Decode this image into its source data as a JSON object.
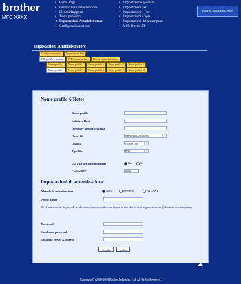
{
  "brand": {
    "logo": "brother",
    "model": "MFC-XXXX"
  },
  "nav": {
    "col1": [
      "Home Page",
      "Informazioni manutenzione",
      "Elenchi/Rapporti",
      "Trova periferica",
      "Impostazioni Amministratore",
      "Configurazione di rete"
    ],
    "col2": [
      "Impostazione generale",
      "Impostazioni fax",
      "Impostazioni I-Fax",
      "Impostazioni Copia",
      "Impostazioni della stampante",
      "USB Diretto I/F"
    ],
    "shortcut": "Brother Solutions Center"
  },
  "crumb": {
    "title": "Impostazioni Amministratore"
  },
  "tabs": {
    "row1": [
      "Configura password",
      "Impostazioni Web"
    ],
    "row2": [
      "FTP/profilo scansione",
      "FTP/Scan scansione",
      "Blocco funzioni sicurezza"
    ],
    "row3": [
      "Nome profilo 1",
      "Nome profilo 2",
      "Nome profilo 3",
      "Nome profilo 4",
      "Nome profilo 5"
    ],
    "row4": [
      "Nome profilo 6",
      "Nome profilo 7",
      "Nome profilo 8",
      "Nome profilo 9",
      "Nome profilo 10"
    ]
  },
  "form": {
    "title": "Nome profilo 6(Rete)",
    "fields": {
      "nome_profilo": "Nome profilo",
      "indirizzo_host": "Indirizzo Host",
      "directory": "Directory memorizzazione",
      "nome_file": "Nome file",
      "qualita": "Qualità",
      "tipo_file": "Tipo file",
      "usa_pin": "Usa PIN per autenticazione",
      "codice_pin": "Codice PIN"
    },
    "values": {
      "nome_file_value": "BRN001BA9000954",
      "qualita_value": "Colore 100",
      "tipo_file_value": "PDF",
      "codice_pin_value": "0000"
    },
    "pin_options": [
      "No",
      "Sì"
    ]
  },
  "auth": {
    "title": "Impostazioni di autenticazione",
    "metodo": "Metodo di autenticazione",
    "methods": [
      "Auto",
      "Kerberos",
      "NTLMv2"
    ],
    "nome_utente": "Nome utente",
    "note": "Se il nome utente fa parte di un dominio, immettere il nome utente in uno dei formati seguenti: utente@dominio dominio\\utente",
    "password": "Password",
    "conferma": "Conferma password",
    "kerberos": "Indirizzo server Kerberos"
  },
  "buttons": {
    "cancel": "Annulla",
    "send": "Inoltra"
  },
  "footer": {
    "copyright": "Copyright(C) 2000-2009 Brother Industries, Ltd. All Rights Reserved."
  }
}
